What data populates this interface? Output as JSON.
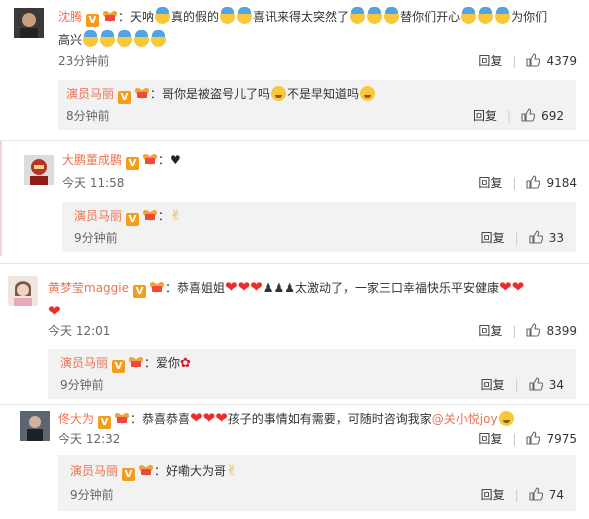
{
  "comments": [
    {
      "user": "沈腾",
      "text_a": "：天呐",
      "text_b": "真的假的",
      "text_c": "喜讯来得太突然了",
      "text_d": "替你们开心",
      "text_e": "为你们",
      "text_f": "高兴",
      "time": "23分钟前",
      "reply_label": "回复",
      "likes": "4379",
      "reply": {
        "user": "演员马丽",
        "text_a": "：哥你是被盗号儿了吗",
        "text_b": "不是早知道吗",
        "time": "8分钟前",
        "reply_label": "回复",
        "likes": "692"
      }
    },
    {
      "user": "大鹏董成鹏",
      "text_a": "：",
      "time": "今天 11:58",
      "reply_label": "回复",
      "likes": "9184",
      "reply": {
        "user": "演员马丽",
        "text_a": "：",
        "time": "9分钟前",
        "reply_label": "回复",
        "likes": "33"
      }
    },
    {
      "user": "黄梦莹maggie",
      "text_a": "：恭喜姐姐",
      "text_b": "太激动了，一家三口幸福快乐平安健康",
      "time": "今天 12:01",
      "reply_label": "回复",
      "likes": "8399",
      "reply": {
        "user": "演员马丽",
        "text_a": "：爱你",
        "time": "9分钟前",
        "reply_label": "回复",
        "likes": "34"
      }
    },
    {
      "user": "佟大为",
      "text_a": "：恭喜恭喜",
      "text_b": "孩子的事情如有需要，可随时咨询我家",
      "mention": "@关小悦joy",
      "time": "今天 12:32",
      "reply_label": "回复",
      "likes": "7975",
      "reply": {
        "user": "演员马丽",
        "text_a": "：好嘞大为哥",
        "time": "9分钟前",
        "reply_label": "回复",
        "likes": "74"
      }
    }
  ],
  "badges": {
    "v_label": "V"
  },
  "colors": {
    "username": "#eb7350",
    "reply_bg": "#f2f2f2",
    "vip": "#f59c1d"
  }
}
